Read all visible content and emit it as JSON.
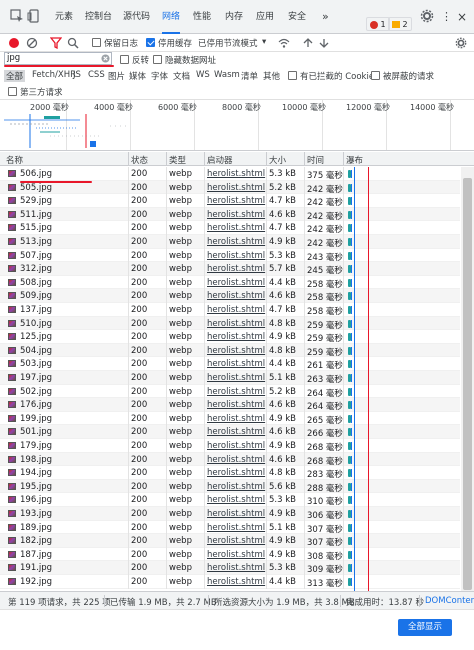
{
  "tabs": [
    {
      "label": "元素"
    },
    {
      "label": "控制台"
    },
    {
      "label": "源代码"
    },
    {
      "label": "网络"
    },
    {
      "label": "性能"
    },
    {
      "label": "内存"
    },
    {
      "label": "应用"
    },
    {
      "label": "安全"
    }
  ],
  "tabbar": {
    "more_label": "»",
    "error_count": "1",
    "warning_count": "2",
    "more_menu_label": "⋮",
    "close_label": "×"
  },
  "toolbar": {
    "preserve_log_label": "保留日志",
    "disable_cache_label": "停用缓存",
    "throttle_label": "已停用节流模式",
    "throttle_arrow": "▾"
  },
  "filter": {
    "value": "jpg",
    "invert_label": "反转",
    "hide_data_urls_label": "隐藏数据网址"
  },
  "types": [
    {
      "label": "全部",
      "selected": true
    },
    {
      "label": "Fetch/XHR"
    },
    {
      "label": "JS"
    },
    {
      "label": "CSS"
    },
    {
      "label": "图片"
    },
    {
      "label": "媒体"
    },
    {
      "label": "字体"
    },
    {
      "label": "文档"
    },
    {
      "label": "WS"
    },
    {
      "label": "Wasm"
    },
    {
      "label": "清单"
    },
    {
      "label": "其他"
    }
  ],
  "typebar": {
    "blocked_cookies_label": "有已拦截的 Cookie",
    "blocked_requests_label": "被屏蔽的请求",
    "third_party_label": "第三方请求"
  },
  "overview": {
    "ticks": [
      "2000 毫秒",
      "4000 毫秒",
      "6000 毫秒",
      "8000 毫秒",
      "10000 毫秒",
      "12000 毫秒",
      "14000 毫秒"
    ]
  },
  "columns": {
    "name": "名称",
    "status": "状态",
    "type": "类型",
    "initiator": "启动器",
    "size": "大小",
    "time": "时间",
    "waterfall": "瀑布"
  },
  "rows": [
    {
      "name": "506.jpg",
      "status": "200",
      "type": "webp",
      "initiator": "herolist.shtml",
      "size": "5.3 kB",
      "time": "375 毫秒"
    },
    {
      "name": "505.jpg",
      "status": "200",
      "type": "webp",
      "initiator": "herolist.shtml",
      "size": "5.2 kB",
      "time": "242 毫秒"
    },
    {
      "name": "529.jpg",
      "status": "200",
      "type": "webp",
      "initiator": "herolist.shtml",
      "size": "4.7 kB",
      "time": "242 毫秒"
    },
    {
      "name": "511.jpg",
      "status": "200",
      "type": "webp",
      "initiator": "herolist.shtml",
      "size": "4.6 kB",
      "time": "242 毫秒"
    },
    {
      "name": "515.jpg",
      "status": "200",
      "type": "webp",
      "initiator": "herolist.shtml",
      "size": "4.7 kB",
      "time": "242 毫秒"
    },
    {
      "name": "513.jpg",
      "status": "200",
      "type": "webp",
      "initiator": "herolist.shtml",
      "size": "4.9 kB",
      "time": "242 毫秒"
    },
    {
      "name": "507.jpg",
      "status": "200",
      "type": "webp",
      "initiator": "herolist.shtml",
      "size": "5.3 kB",
      "time": "243 毫秒"
    },
    {
      "name": "312.jpg",
      "status": "200",
      "type": "webp",
      "initiator": "herolist.shtml",
      "size": "5.7 kB",
      "time": "245 毫秒"
    },
    {
      "name": "508.jpg",
      "status": "200",
      "type": "webp",
      "initiator": "herolist.shtml",
      "size": "4.4 kB",
      "time": "258 毫秒"
    },
    {
      "name": "509.jpg",
      "status": "200",
      "type": "webp",
      "initiator": "herolist.shtml",
      "size": "4.6 kB",
      "time": "258 毫秒"
    },
    {
      "name": "137.jpg",
      "status": "200",
      "type": "webp",
      "initiator": "herolist.shtml",
      "size": "4.7 kB",
      "time": "258 毫秒"
    },
    {
      "name": "510.jpg",
      "status": "200",
      "type": "webp",
      "initiator": "herolist.shtml",
      "size": "4.8 kB",
      "time": "259 毫秒"
    },
    {
      "name": "125.jpg",
      "status": "200",
      "type": "webp",
      "initiator": "herolist.shtml",
      "size": "4.9 kB",
      "time": "259 毫秒"
    },
    {
      "name": "504.jpg",
      "status": "200",
      "type": "webp",
      "initiator": "herolist.shtml",
      "size": "4.8 kB",
      "time": "259 毫秒"
    },
    {
      "name": "503.jpg",
      "status": "200",
      "type": "webp",
      "initiator": "herolist.shtml",
      "size": "4.4 kB",
      "time": "261 毫秒"
    },
    {
      "name": "197.jpg",
      "status": "200",
      "type": "webp",
      "initiator": "herolist.shtml",
      "size": "5.1 kB",
      "time": "263 毫秒"
    },
    {
      "name": "502.jpg",
      "status": "200",
      "type": "webp",
      "initiator": "herolist.shtml",
      "size": "5.2 kB",
      "time": "264 毫秒"
    },
    {
      "name": "176.jpg",
      "status": "200",
      "type": "webp",
      "initiator": "herolist.shtml",
      "size": "4.6 kB",
      "time": "264 毫秒"
    },
    {
      "name": "199.jpg",
      "status": "200",
      "type": "webp",
      "initiator": "herolist.shtml",
      "size": "4.9 kB",
      "time": "265 毫秒"
    },
    {
      "name": "501.jpg",
      "status": "200",
      "type": "webp",
      "initiator": "herolist.shtml",
      "size": "4.6 kB",
      "time": "266 毫秒"
    },
    {
      "name": "179.jpg",
      "status": "200",
      "type": "webp",
      "initiator": "herolist.shtml",
      "size": "4.9 kB",
      "time": "268 毫秒"
    },
    {
      "name": "198.jpg",
      "status": "200",
      "type": "webp",
      "initiator": "herolist.shtml",
      "size": "4.6 kB",
      "time": "268 毫秒"
    },
    {
      "name": "194.jpg",
      "status": "200",
      "type": "webp",
      "initiator": "herolist.shtml",
      "size": "4.8 kB",
      "time": "283 毫秒"
    },
    {
      "name": "195.jpg",
      "status": "200",
      "type": "webp",
      "initiator": "herolist.shtml",
      "size": "5.6 kB",
      "time": "288 毫秒"
    },
    {
      "name": "196.jpg",
      "status": "200",
      "type": "webp",
      "initiator": "herolist.shtml",
      "size": "5.3 kB",
      "time": "310 毫秒"
    },
    {
      "name": "193.jpg",
      "status": "200",
      "type": "webp",
      "initiator": "herolist.shtml",
      "size": "4.9 kB",
      "time": "306 毫秒"
    },
    {
      "name": "189.jpg",
      "status": "200",
      "type": "webp",
      "initiator": "herolist.shtml",
      "size": "5.1 kB",
      "time": "307 毫秒"
    },
    {
      "name": "182.jpg",
      "status": "200",
      "type": "webp",
      "initiator": "herolist.shtml",
      "size": "4.9 kB",
      "time": "307 毫秒"
    },
    {
      "name": "187.jpg",
      "status": "200",
      "type": "webp",
      "initiator": "herolist.shtml",
      "size": "4.9 kB",
      "time": "308 毫秒"
    },
    {
      "name": "191.jpg",
      "status": "200",
      "type": "webp",
      "initiator": "herolist.shtml",
      "size": "5.3 kB",
      "time": "309 毫秒"
    },
    {
      "name": "192.jpg",
      "status": "200",
      "type": "webp",
      "initiator": "herolist.shtml",
      "size": "4.4 kB",
      "time": "313 毫秒"
    }
  ],
  "status": {
    "requests": "第 119 项请求，共 225 项",
    "transferred": "已传输 1.9 MB，共 2.7 MB",
    "resources": "所选资源大小为 1.9 MB，共 3.8 MB",
    "finish": "完成用时：13.87 秒",
    "dom_content": "DOMContent"
  },
  "bottom": {
    "show_all_label": "全部显示"
  },
  "colors": {
    "accent": "#1a73e8",
    "record": "#e8172a",
    "annotation": "#e8172a"
  },
  "icons": [
    "inspect-icon",
    "device-icon",
    "settings-icon",
    "record-icon",
    "clear-icon",
    "filter-icon",
    "search-icon",
    "wifi-icon",
    "upload-icon",
    "download-icon",
    "clear-filter-icon"
  ]
}
